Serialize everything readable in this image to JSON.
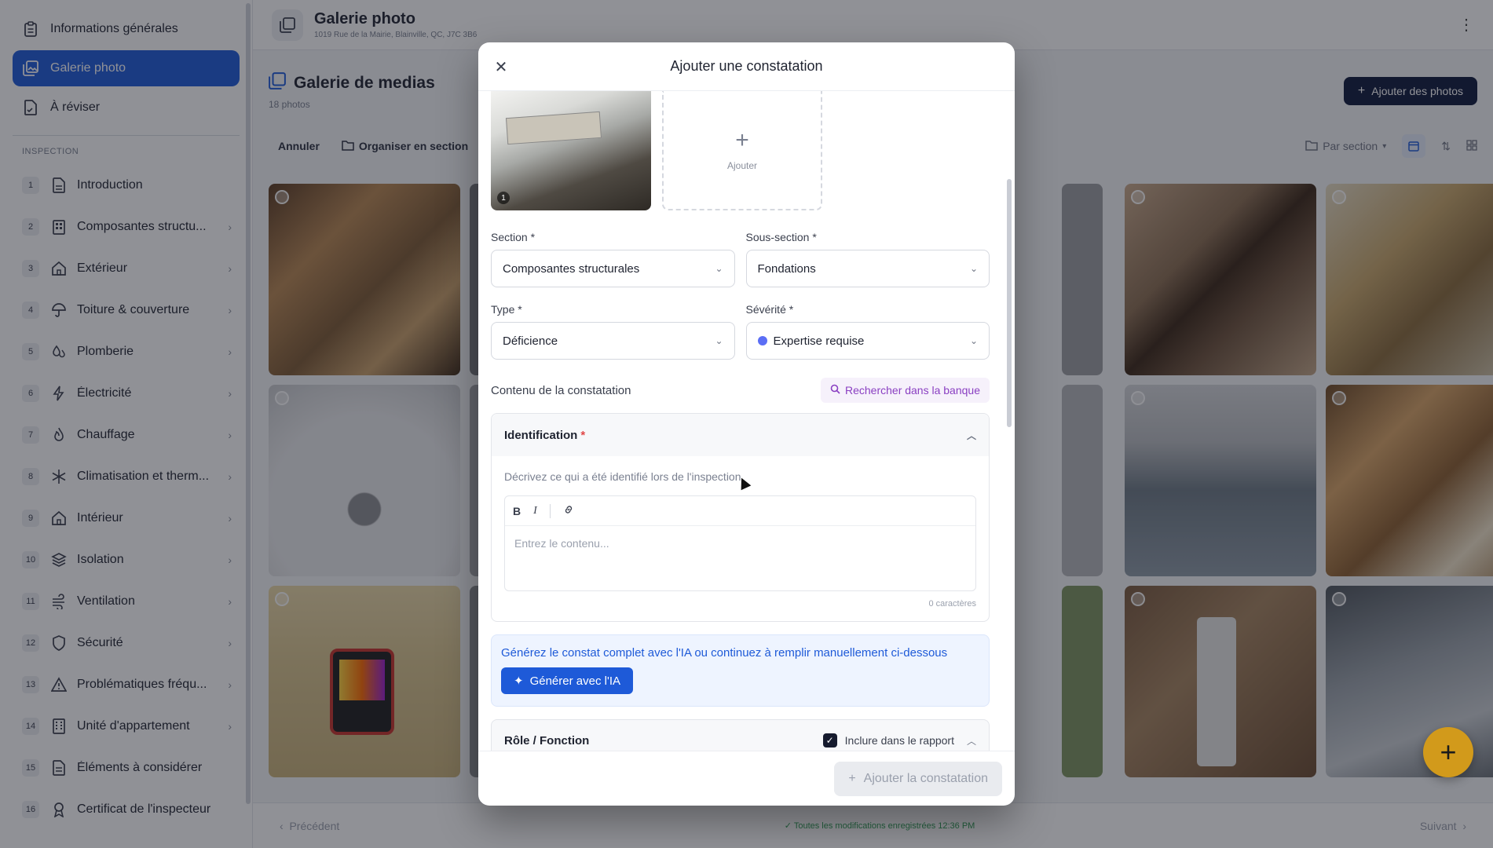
{
  "sidebar": {
    "top_links": [
      {
        "label": "Informations générales",
        "icon": "clipboard-icon",
        "active": false
      },
      {
        "label": "Galerie photo",
        "icon": "gallery-icon",
        "active": true
      },
      {
        "label": "À réviser",
        "icon": "review-doc-icon",
        "active": false
      }
    ],
    "section_label": "INSPECTION",
    "items": [
      {
        "num": "1",
        "label": "Introduction",
        "icon": "document-icon",
        "chevron": false
      },
      {
        "num": "2",
        "label": "Composantes structu...",
        "icon": "building-icon",
        "chevron": true
      },
      {
        "num": "3",
        "label": "Extérieur",
        "icon": "house-icon",
        "chevron": true
      },
      {
        "num": "4",
        "label": "Toiture & couverture",
        "icon": "umbrella-icon",
        "chevron": true
      },
      {
        "num": "5",
        "label": "Plomberie",
        "icon": "droplets-icon",
        "chevron": true
      },
      {
        "num": "6",
        "label": "Électricité",
        "icon": "bolt-icon",
        "chevron": true
      },
      {
        "num": "7",
        "label": "Chauffage",
        "icon": "flame-icon",
        "chevron": true
      },
      {
        "num": "8",
        "label": "Climatisation et therm...",
        "icon": "snowflake-icon",
        "chevron": true
      },
      {
        "num": "9",
        "label": "Intérieur",
        "icon": "home-icon",
        "chevron": true
      },
      {
        "num": "10",
        "label": "Isolation",
        "icon": "layers-icon",
        "chevron": true
      },
      {
        "num": "11",
        "label": "Ventilation",
        "icon": "wind-icon",
        "chevron": true
      },
      {
        "num": "12",
        "label": "Sécurité",
        "icon": "shield-icon",
        "chevron": true
      },
      {
        "num": "13",
        "label": "Problématiques fréqu...",
        "icon": "warning-icon",
        "chevron": true
      },
      {
        "num": "14",
        "label": "Unité d'appartement",
        "icon": "apartment-icon",
        "chevron": true
      },
      {
        "num": "15",
        "label": "Éléments à considérer",
        "icon": "list-doc-icon",
        "chevron": false
      },
      {
        "num": "16",
        "label": "Certificat de l'inspecteur",
        "icon": "award-icon",
        "chevron": false
      }
    ]
  },
  "topbar": {
    "title": "Galerie photo",
    "address": "1019 Rue de la Mairie, Blainville, QC, J7C 3B6"
  },
  "gallery": {
    "title": "Galerie de medias",
    "count": "18 photos",
    "add_button": "Ajouter des photos",
    "toolbar": {
      "cancel": "Annuler",
      "organize": "Organiser en section",
      "group_by": "Par section"
    }
  },
  "footer": {
    "prev": "Précédent",
    "saved": "Toutes les modifications enregistrées 12:36 PM",
    "next": "Suivant"
  },
  "modal": {
    "title": "Ajouter une constatation",
    "thumb_index": "1",
    "add_tile_label": "Ajouter",
    "fields": {
      "section": {
        "label": "Section *",
        "value": "Composantes structurales"
      },
      "subsection": {
        "label": "Sous-section *",
        "value": "Fondations"
      },
      "type": {
        "label": "Type *",
        "value": "Déficience"
      },
      "severity": {
        "label": "Sévérité *",
        "value": "Expertise requise",
        "color": "#5b6ef5"
      }
    },
    "content_label": "Contenu de la constatation",
    "search_bank": "Rechercher dans la banque",
    "identification": {
      "title": "Identification",
      "required_mark": "*",
      "help": "Décrivez ce qui a été identifié lors de l'inspection",
      "placeholder": "Entrez le contenu...",
      "char_count": "0 caractères"
    },
    "ai": {
      "text": "Générez le constat complet avec l'IA ou continuez à remplir manuellement ci-dessous",
      "button": "Générer avec l'IA"
    },
    "role": {
      "title": "Rôle / Fonction",
      "include_label": "Inclure dans le rapport",
      "include_checked": true
    },
    "submit": "Ajouter la constatation"
  },
  "colors": {
    "accent": "#1e5ad8",
    "dark_button": "#0f1a3d",
    "fab": "#d29a1b",
    "ai_purple": "#8a3fc2"
  }
}
